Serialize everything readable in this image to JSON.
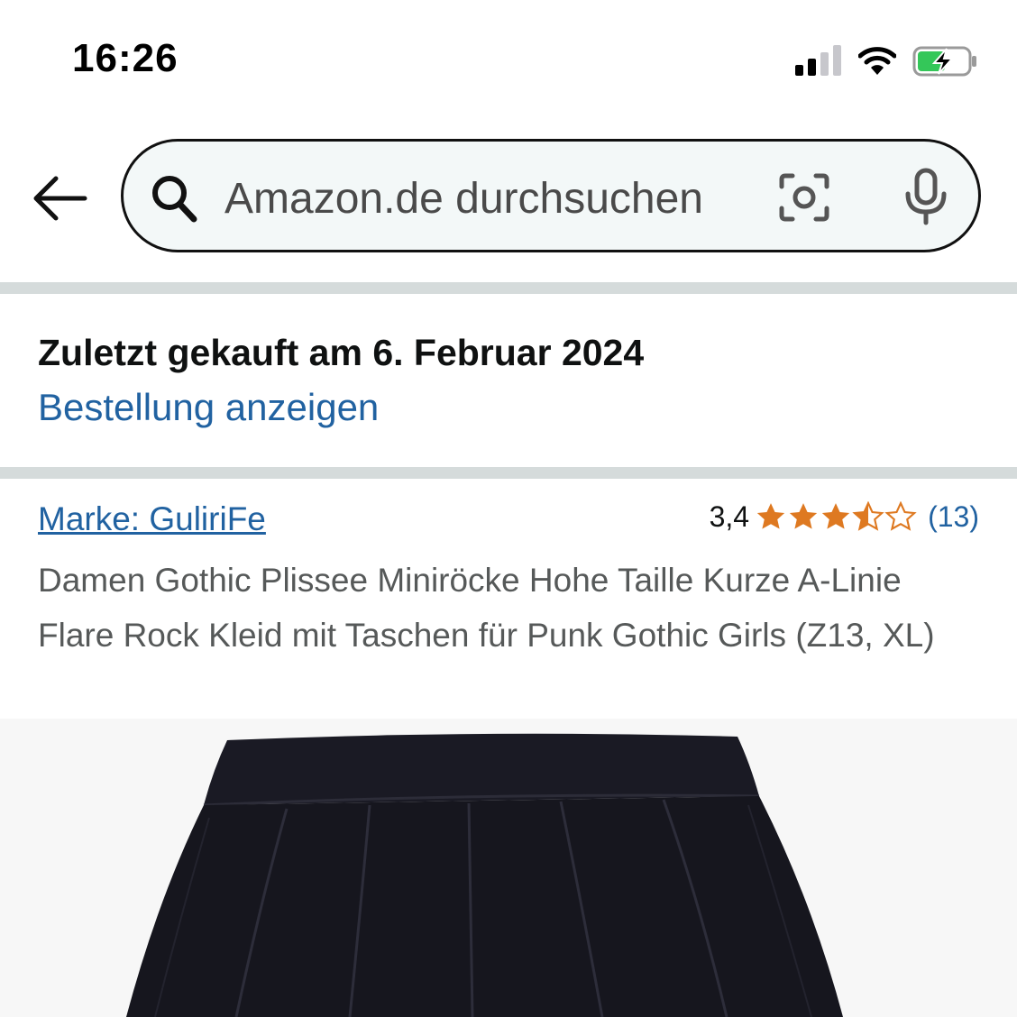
{
  "status_bar": {
    "time": "16:26",
    "icons": [
      "cellular-signal-icon",
      "wifi-icon",
      "battery-charging-icon"
    ]
  },
  "search": {
    "placeholder": "Amazon.de durchsuchen",
    "icons": [
      "back-arrow-icon",
      "search-icon",
      "camera-icon",
      "microphone-icon"
    ]
  },
  "purchase": {
    "title": "Zuletzt gekauft am 6. Februar 2024",
    "link": "Bestellung anzeigen"
  },
  "product": {
    "brand_link": "Marke: GuliriFe",
    "rating": 3.4,
    "rating_text": "3,4",
    "review_count": "(13)",
    "title": "Damen Gothic Plissee Miniröcke Hohe Taille Kurze A-Linie Flare Rock Kleid mit Taschen für Punk Gothic Girls (Z13, XL)"
  },
  "colors": {
    "link": "#2162a1",
    "star": "#de7921",
    "divider": "#d5dbdb",
    "search_bg": "#f3f8f8",
    "battery_green": "#34c759",
    "image_bg": "#f7f7f7",
    "skirt": "#16161e"
  }
}
